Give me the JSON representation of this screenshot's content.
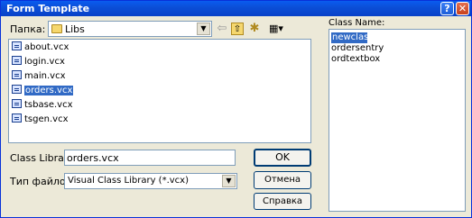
{
  "window": {
    "title": "Form Template",
    "help_glyph": "?",
    "close_glyph": "✕"
  },
  "folder": {
    "label": "Папка:",
    "value": "Libs"
  },
  "toolbar": {
    "back_glyph": "⇦",
    "up_glyph": "⇧",
    "newfolder_glyph": "✱",
    "view_glyph": "▦▾"
  },
  "files": [
    {
      "name": "about.vcx",
      "selected": false
    },
    {
      "name": "login.vcx",
      "selected": false
    },
    {
      "name": "main.vcx",
      "selected": false
    },
    {
      "name": "orders.vcx",
      "selected": true
    },
    {
      "name": "tsbase.vcx",
      "selected": false
    },
    {
      "name": "tsgen.vcx",
      "selected": false
    }
  ],
  "class_library": {
    "label": "Class Library",
    "value": "orders.vcx"
  },
  "file_type": {
    "label": "Тип файлов:",
    "value": "Visual Class Library (*.vcx)"
  },
  "buttons": {
    "ok": "OK",
    "cancel": "Отмена",
    "help": "Справка"
  },
  "class_name": {
    "label": "Class Name:",
    "items": [
      {
        "name": "newclass",
        "selected": true
      },
      {
        "name": "ordersentry",
        "selected": false
      },
      {
        "name": "ordtextbox",
        "selected": false
      }
    ]
  }
}
